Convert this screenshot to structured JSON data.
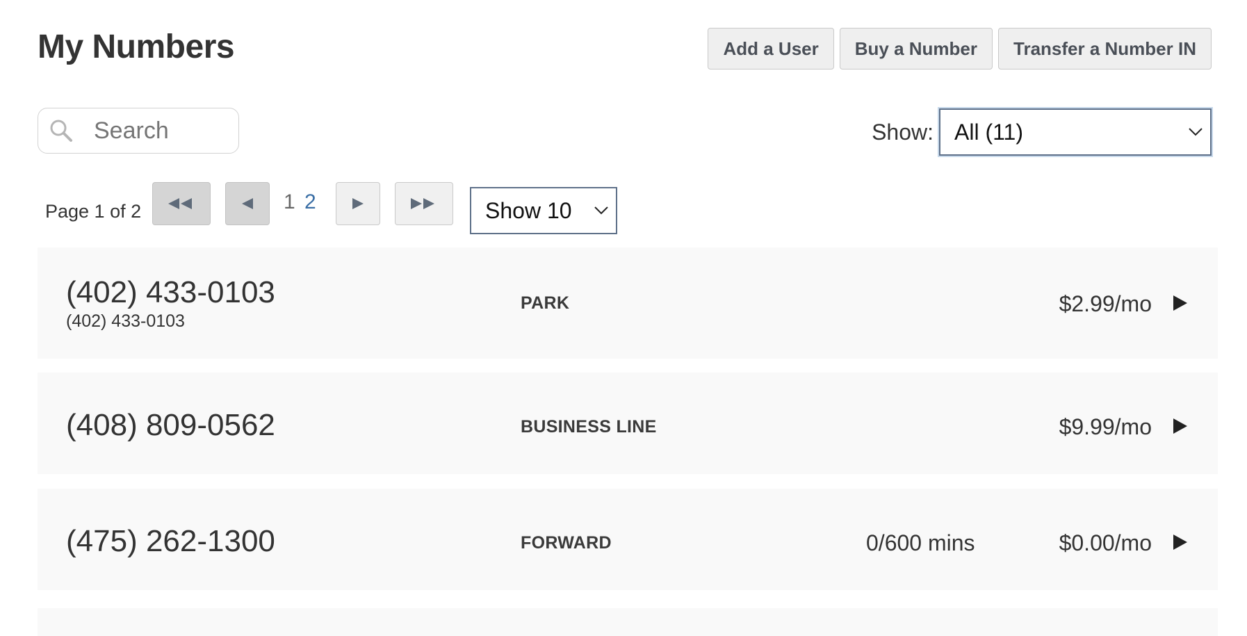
{
  "page": {
    "title": "My Numbers"
  },
  "toolbar": {
    "add_user_label": "Add a User",
    "buy_number_label": "Buy a Number",
    "transfer_number_label": "Transfer a Number IN"
  },
  "search": {
    "placeholder": "Search",
    "value": "",
    "icon": "search-icon"
  },
  "filter": {
    "label": "Show:",
    "selected": "All (11)"
  },
  "pagination": {
    "info": "Page 1 of 2",
    "first_icon": "double-left-arrow-icon",
    "prev_icon": "left-arrow-icon",
    "next_icon": "right-arrow-icon",
    "last_icon": "double-right-arrow-icon",
    "pages": [
      "1",
      "2"
    ],
    "current_page": "1",
    "per_page": "Show 10"
  },
  "numbers": [
    {
      "number": "(402) 433-0103",
      "subtitle": "(402) 433-0103",
      "type": "PARK",
      "minutes": "",
      "price": "$2.99/mo"
    },
    {
      "number": "(408) 809-0562",
      "subtitle": "",
      "type": "BUSINESS LINE",
      "minutes": "",
      "price": "$9.99/mo"
    },
    {
      "number": "(475) 262-1300",
      "subtitle": "",
      "type": "FORWARD",
      "minutes": "0/600 mins",
      "price": "$0.00/mo"
    }
  ],
  "colors": {
    "row_background": "#f9f9f9",
    "button_background": "#efefef",
    "disabled_button": "#d5d5d5",
    "link": "#3a6ea5",
    "select_border": "#5e7089"
  }
}
